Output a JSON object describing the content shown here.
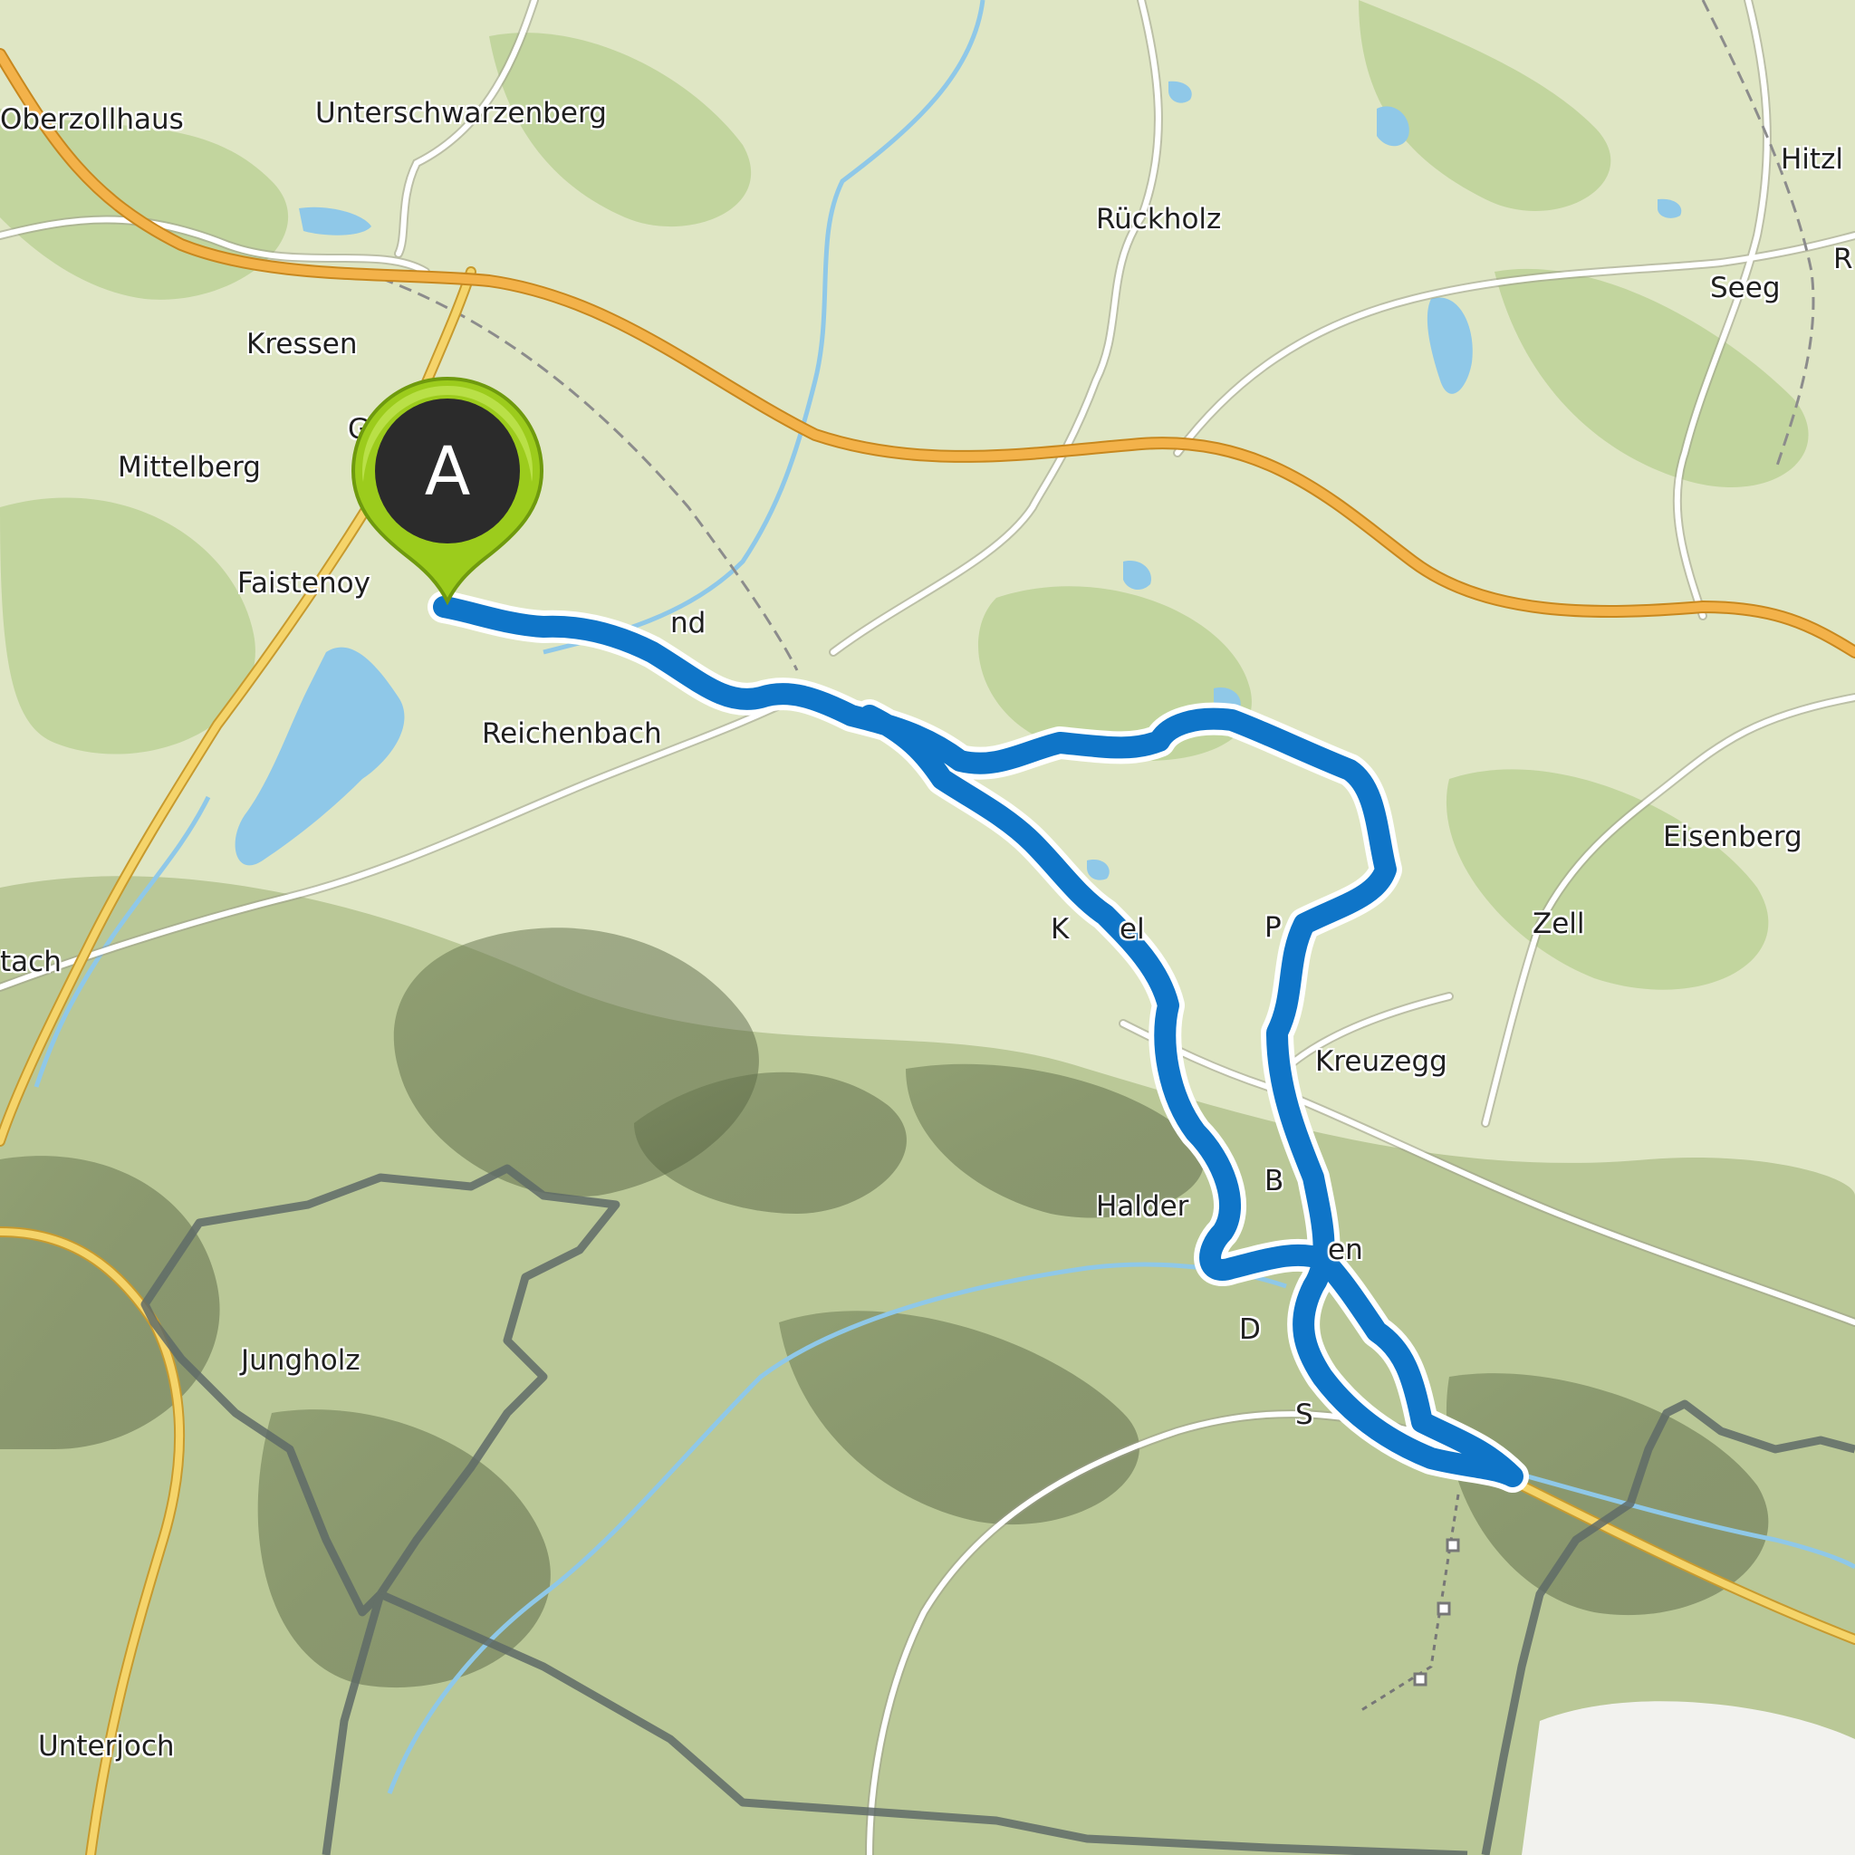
{
  "map": {
    "colors": {
      "land": "#dfe6c4",
      "forest": "#b8cf92",
      "water": "#8fc8e8",
      "motorway": "#f3b24a",
      "primary_road": "#f5d46a",
      "minor_road": "#ffffff",
      "border": "#5f6b67",
      "route": "#0f75c8",
      "route_casing": "#ffffff",
      "marker_fill": "#9ccc1c",
      "marker_center": "#2b2b2b"
    },
    "start_marker": {
      "letter": "A",
      "icon": "map-pin-icon"
    },
    "place_labels": [
      {
        "text": "Oberzollhaus"
      },
      {
        "text": "Unterschwarzenberg"
      },
      {
        "text": "Rückholz"
      },
      {
        "text": "Hitzl"
      },
      {
        "text": "Seeg"
      },
      {
        "text": "Kressen"
      },
      {
        "text": "Mittelberg"
      },
      {
        "text": "Faistenoy"
      },
      {
        "text": "nd"
      },
      {
        "text": "Reichenbach"
      },
      {
        "text": "Eisenberg"
      },
      {
        "text": "Zell"
      },
      {
        "text": "K"
      },
      {
        "text": "el"
      },
      {
        "text": "P"
      },
      {
        "text": "tach"
      },
      {
        "text": "Kreuzegg"
      },
      {
        "text": "Halder"
      },
      {
        "text": "B"
      },
      {
        "text": "en"
      },
      {
        "text": "D"
      },
      {
        "text": "S"
      },
      {
        "text": "Jungholz"
      },
      {
        "text": "Unterjoch"
      },
      {
        "text": "G"
      },
      {
        "text": "R"
      }
    ]
  }
}
